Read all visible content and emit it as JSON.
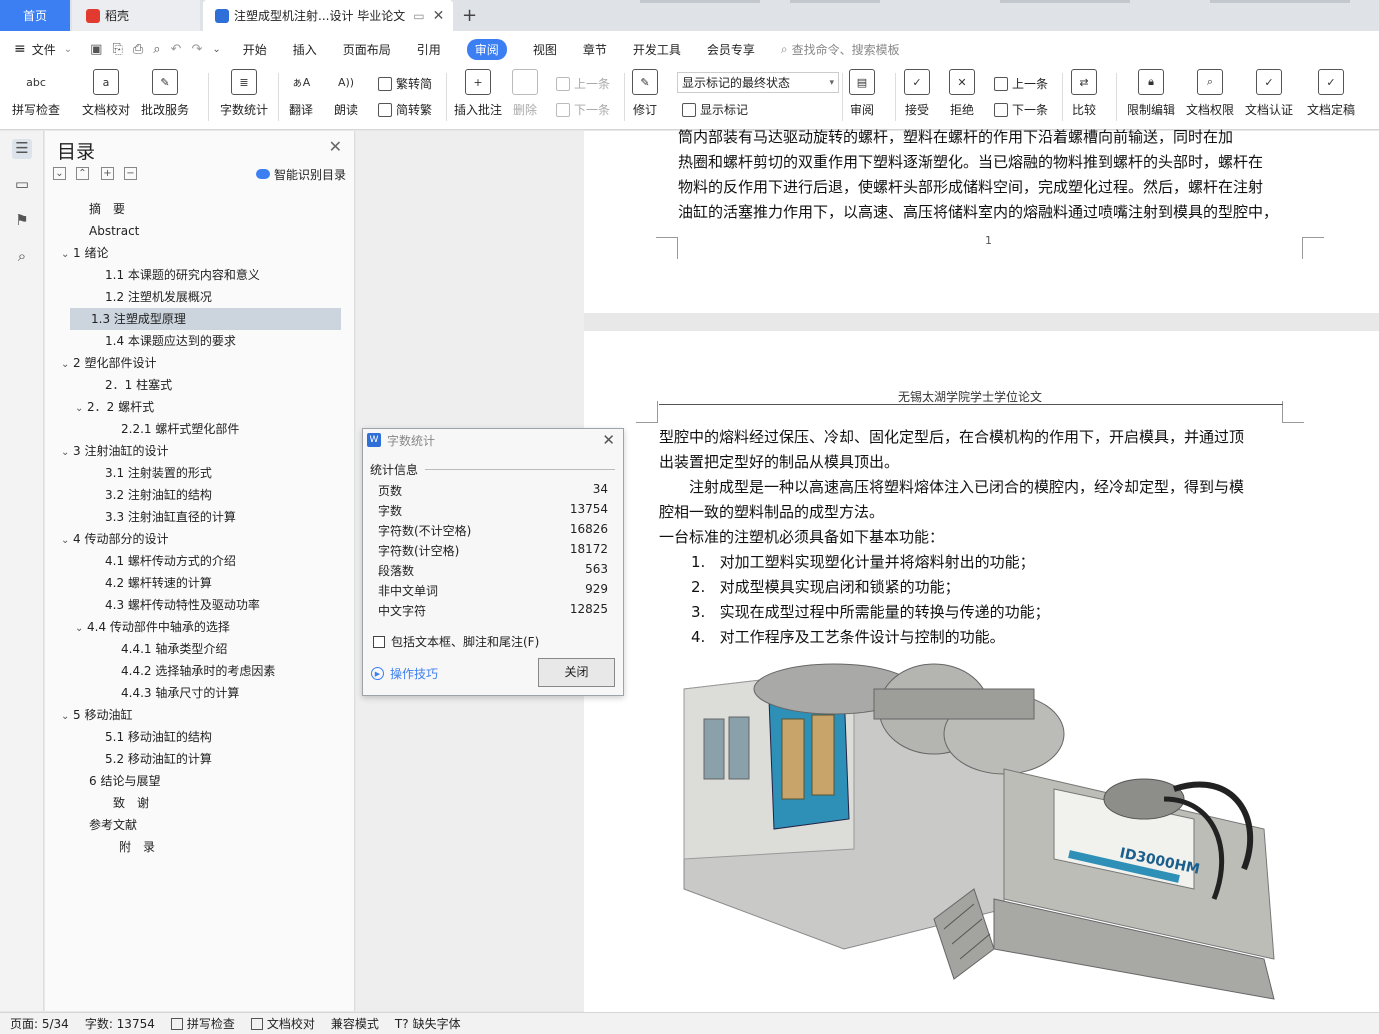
{
  "tabs": {
    "home": "首页",
    "daoke": "稻壳",
    "doc": "注塑成型机注射...设计 毕业论文"
  },
  "menu": [
    "文件",
    "开始",
    "插入",
    "页面布局",
    "引用",
    "审阅",
    "视图",
    "章节",
    "开发工具",
    "会员专享"
  ],
  "menu_search": "查找命令、搜索模板",
  "ribbon": {
    "spell": "拼写检查",
    "proof": "文档校对",
    "batch": "批改服务",
    "count": "字数统计",
    "translate": "翻译",
    "read": "朗读",
    "t2s": "繁转简",
    "s2t": "简转繁",
    "comment": "插入批注",
    "delete": "删除",
    "prev_c": "上一条",
    "next_c": "下一条",
    "revise": "修订",
    "markup_select": "显示标记的最终状态",
    "show_mark": "显示标记",
    "review": "审阅",
    "accept": "接受",
    "reject": "拒绝",
    "prev": "上一条",
    "next": "下一条",
    "compare": "比较",
    "restrict": "限制编辑",
    "rights": "文档权限",
    "cert": "文档认证",
    "finalize": "文档定稿"
  },
  "toc": {
    "title": "目录",
    "smart": "智能识别目录",
    "items": [
      {
        "label": "摘　要",
        "level": 1,
        "arrow": false
      },
      {
        "label": "Abstract",
        "level": 1,
        "arrow": false
      },
      {
        "label": "1  绪论",
        "level": 0,
        "arrow": true
      },
      {
        "label": "1.1  本课题的研究内容和意义",
        "level": 2,
        "arrow": false
      },
      {
        "label": "1.2  注塑机发展概况",
        "level": 2,
        "arrow": false
      },
      {
        "label": "1.3 注塑成型原理",
        "level": 2,
        "arrow": false,
        "selected": true
      },
      {
        "label": "1.4 本课题应达到的要求",
        "level": 2,
        "arrow": false
      },
      {
        "label": "2  塑化部件设计",
        "level": 0,
        "arrow": true
      },
      {
        "label": "2．1 柱塞式",
        "level": 2,
        "arrow": false
      },
      {
        "label": "2．2  螺杆式",
        "level": 3,
        "arrow": true
      },
      {
        "label": "2.2.1  螺杆式塑化部件",
        "level": 4,
        "arrow": false
      },
      {
        "label": "3  注射油缸的设计",
        "level": 0,
        "arrow": true
      },
      {
        "label": "3.1  注射装置的形式",
        "level": 2,
        "arrow": false
      },
      {
        "label": "3.2  注射油缸的结构",
        "level": 2,
        "arrow": false
      },
      {
        "label": "3.3  注射油缸直径的计算",
        "level": 2,
        "arrow": false
      },
      {
        "label": "4  传动部分的设计",
        "level": 0,
        "arrow": true
      },
      {
        "label": "4.1  螺杆传动方式的介绍",
        "level": 2,
        "arrow": false
      },
      {
        "label": "4.2  螺杆转速的计算",
        "level": 2,
        "arrow": false
      },
      {
        "label": "4.3  螺杆传动特性及驱动功率",
        "level": 2,
        "arrow": false
      },
      {
        "label": "4.4 传动部件中轴承的选择",
        "level": 3,
        "arrow": true
      },
      {
        "label": "4.4.1  轴承类型介绍",
        "level": 5,
        "arrow": false
      },
      {
        "label": "4.4.2  选择轴承时的考虑因素",
        "level": 5,
        "arrow": false
      },
      {
        "label": "4.4.3  轴承尺寸的计算",
        "level": 5,
        "arrow": false
      },
      {
        "label": "5  移动油缸",
        "level": 0,
        "arrow": true
      },
      {
        "label": "5.1  移动油缸的结构",
        "level": 2,
        "arrow": false
      },
      {
        "label": "5.2  移动油缸的计算",
        "level": 2,
        "arrow": false
      },
      {
        "label": "6  结论与展望",
        "level": 1,
        "arrow": false
      },
      {
        "label": "致　谢",
        "level": 6,
        "arrow": false
      },
      {
        "label": "参考文献",
        "level": 1,
        "arrow": false
      },
      {
        "label": "附　录",
        "level": 7,
        "arrow": false
      }
    ]
  },
  "page1": {
    "lines": [
      "筒内部装有马达驱动旋转的螺杆，塑料在螺杆的作用下沿着螺槽向前输送，同时在加",
      "热圈和螺杆剪切的双重作用下塑料逐渐塑化。当已熔融的物料推到螺杆的头部时，螺杆在",
      "物料的反作用下进行后退，使螺杆头部形成储料空间，完成塑化过程。然后，螺杆在注射",
      "油缸的活塞推力作用下，以高速、高压将储料室内的熔融料通过喷嘴注射到模具的型腔中，"
    ],
    "page_number": "1"
  },
  "page2": {
    "header": "无锡太湖学院学士学位论文",
    "lines": [
      "型腔中的熔料经过保压、冷却、固化定型后，在合模机构的作用下，开启模具，并通过顶",
      "出装置把定型好的制品从模具顶出。",
      "　　注射成型是一种以高速高压将塑料熔体注入已闭合的模腔内，经冷却定型，得到与模",
      "腔相一致的塑料制品的成型方法。",
      "一台标准的注塑机必须具备如下基本功能："
    ],
    "list": [
      {
        "num": "1.",
        "text": "对加工塑料实现塑化计量并将熔料射出的功能；"
      },
      {
        "num": "2.",
        "text": "对成型模具实现启闭和锁紧的功能；"
      },
      {
        "num": "3.",
        "text": "实现在成型过程中所需能量的转换与传递的功能；"
      },
      {
        "num": "4.",
        "text": "对工作程序及工艺条件设计与控制的功能。"
      }
    ],
    "machine_label": "ID3000HM"
  },
  "dialog": {
    "title": "字数统计",
    "section": "统计信息",
    "rows": [
      {
        "label": "页数",
        "value": "34"
      },
      {
        "label": "字数",
        "value": "13754"
      },
      {
        "label": "字符数(不计空格)",
        "value": "16826"
      },
      {
        "label": "字符数(计空格)",
        "value": "18172"
      },
      {
        "label": "段落数",
        "value": "563"
      },
      {
        "label": "非中文单词",
        "value": "929"
      },
      {
        "label": "中文字符",
        "value": "12825"
      }
    ],
    "checkbox": "包括文本框、脚注和尾注(F)",
    "tips": "操作技巧",
    "close": "关闭"
  },
  "status": {
    "page": "页面: 5/34",
    "words": "字数: 13754",
    "spell": "拼写检查",
    "proof": "文档校对",
    "compat": "兼容模式",
    "font": "缺失字体"
  }
}
